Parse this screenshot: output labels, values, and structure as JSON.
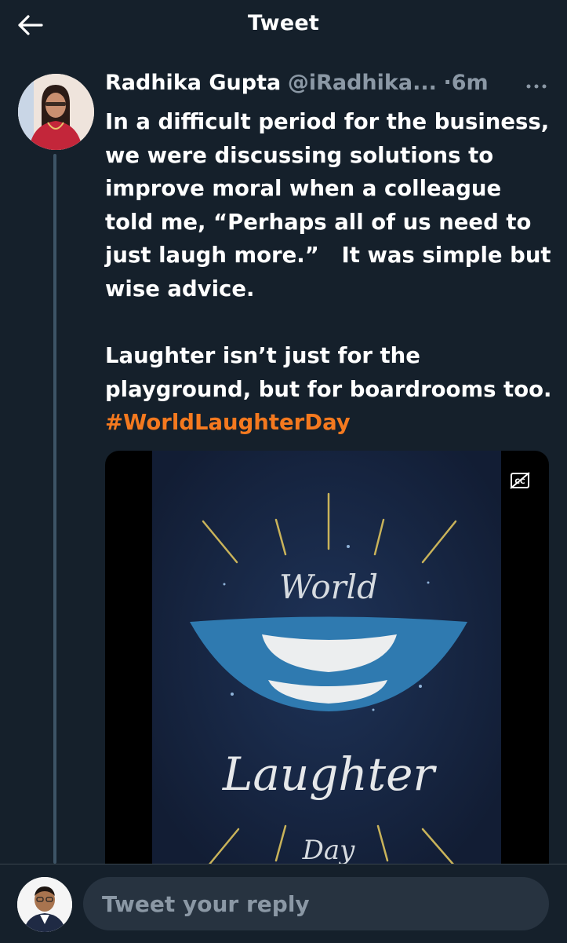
{
  "header": {
    "title": "Tweet",
    "back_icon": "arrow-left-icon"
  },
  "tweet": {
    "author_name": "Radhika Gupta",
    "author_handle": "@iRadhika...",
    "separator": "·",
    "time": "6m",
    "more_icon": "more-horizontal-icon",
    "paragraph1": "In a difficult period for the business, we were discussing solutions to improve moral when a colleague told me, “Perhaps all of us need to just laugh more.”   It was simple but wise advice.",
    "paragraph2": "Laughter isn’t just for the playground, but for boardrooms too. ",
    "hashtag": "#WorldLaughterDay",
    "media": {
      "top_word": "World",
      "main_word": "Laughter",
      "bottom_word": "Day",
      "captions_icon": "closed-captions-icon"
    }
  },
  "reply": {
    "placeholder": "Tweet your reply"
  },
  "colors": {
    "background": "#15202b",
    "text": "#ffffff",
    "muted": "#8b98a5",
    "hashtag": "#f4791f",
    "input_bg": "#273340"
  }
}
